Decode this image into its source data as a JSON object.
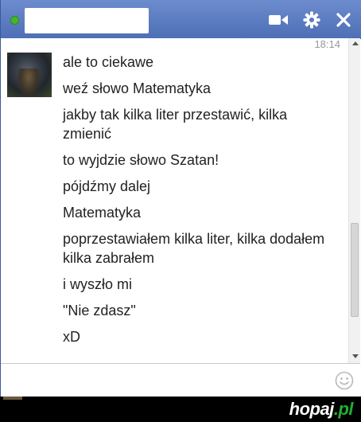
{
  "chat": {
    "timestamp": "18:14",
    "messages": [
      "ale to ciekawe",
      "weź słowo Matematyka",
      "jakby tak kilka liter przestawić, kilka zmienić",
      "to wyjdzie słowo Szatan!",
      "pójdźmy dalej",
      "Matematyka",
      "poprzestawiałem kilka liter, kilka dodałem kilka zabrałem",
      "i wyszło mi",
      "\"Nie zdasz\"",
      "xD"
    ]
  },
  "titlebar": {
    "icons": [
      "video-call-icon",
      "gear-icon",
      "close-icon"
    ],
    "status_color": "#42b72a"
  },
  "compose": {
    "value": "",
    "placeholder": ""
  },
  "footer": {
    "brand_main": "hopaj",
    "brand_tld": ".pl"
  },
  "colors": {
    "titlebar": "#5b7bc0",
    "border": "#3b5998",
    "brand_accent": "#1fb02f"
  }
}
